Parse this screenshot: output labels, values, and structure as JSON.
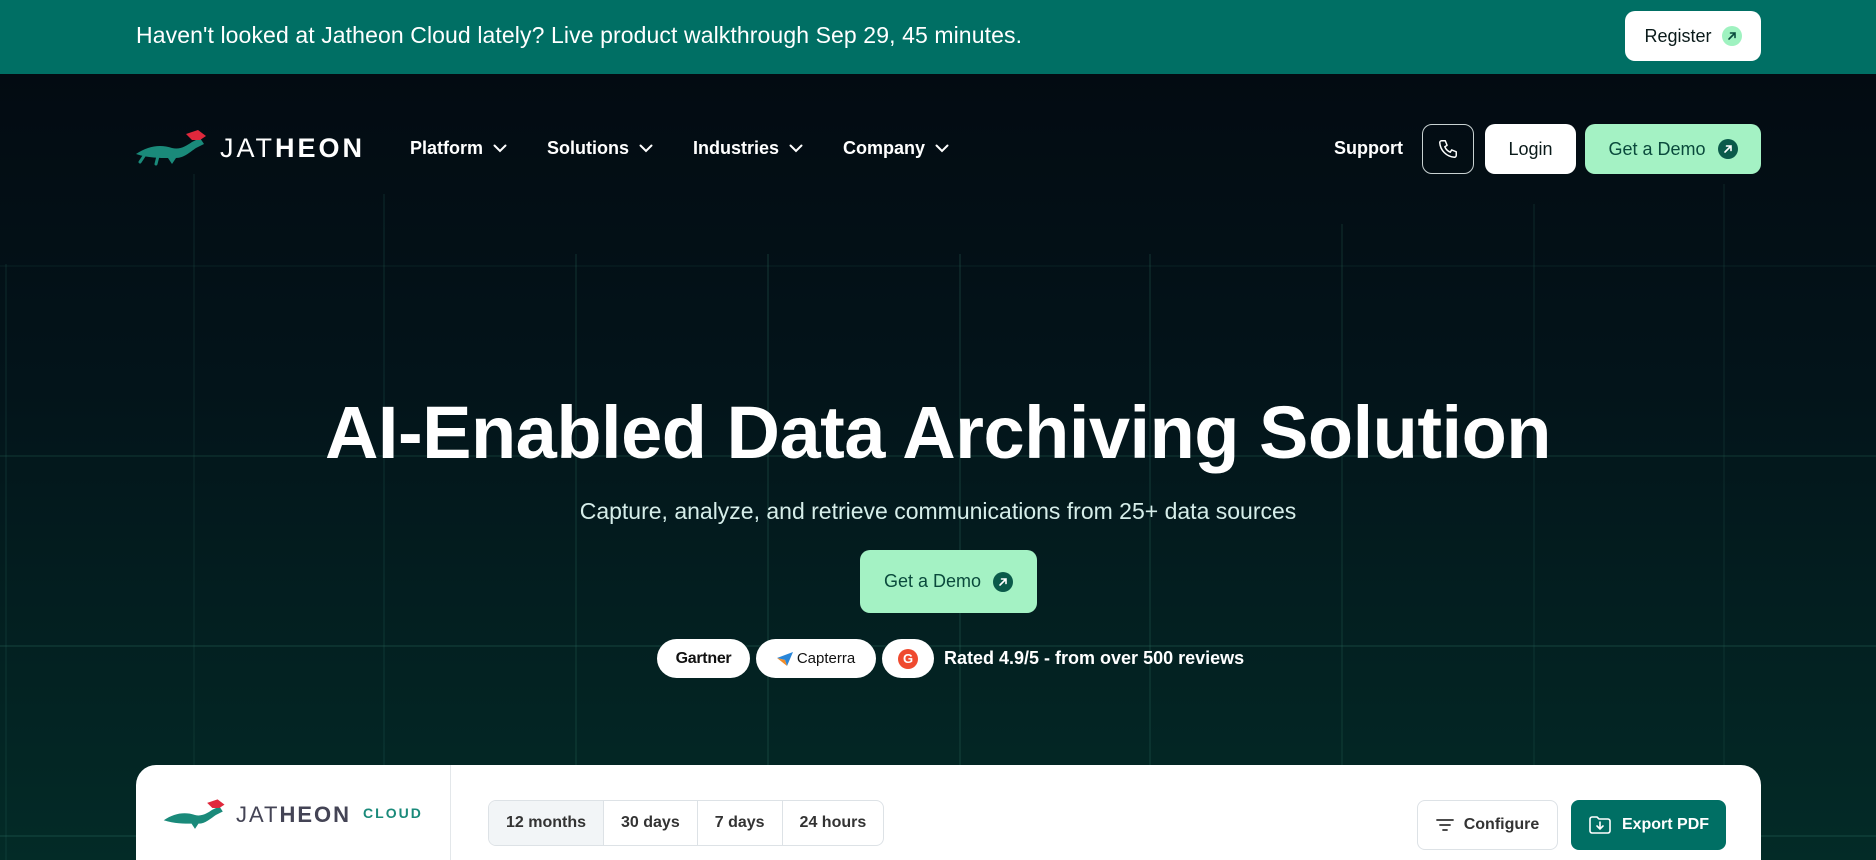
{
  "banner": {
    "text": "Haven't looked at Jatheon Cloud lately? Live product walkthrough Sep 29, 45 minutes.",
    "register_label": "Register"
  },
  "brand": {
    "logo_light": "JAT",
    "logo_bold": "HEON",
    "cloud_word": "CLOUD"
  },
  "nav": {
    "items": [
      {
        "label": "Platform"
      },
      {
        "label": "Solutions"
      },
      {
        "label": "Industries"
      },
      {
        "label": "Company"
      }
    ],
    "support_label": "Support",
    "login_label": "Login",
    "demo_label": "Get a Demo"
  },
  "hero": {
    "title": "AI-Enabled Data Archiving Solution",
    "subtitle": "Capture, analyze, and retrieve communications from 25+ data sources",
    "cta_label": "Get a Demo"
  },
  "reviews": {
    "gartner": "Gartner",
    "capterra": "Capterra",
    "g2": "G",
    "rated_text": "Rated 4.9/5 - from over 500 reviews"
  },
  "dashboard": {
    "ranges": [
      {
        "label": "12 months",
        "active": true
      },
      {
        "label": "30 days",
        "active": false
      },
      {
        "label": "7 days",
        "active": false
      },
      {
        "label": "24 hours",
        "active": false
      }
    ],
    "configure_label": "Configure",
    "export_label": "Export PDF"
  },
  "colors": {
    "brand_teal": "#006f64",
    "mint": "#a4f2c4",
    "logo_red": "#e0283c",
    "logo_teal": "#1a8a7a"
  }
}
